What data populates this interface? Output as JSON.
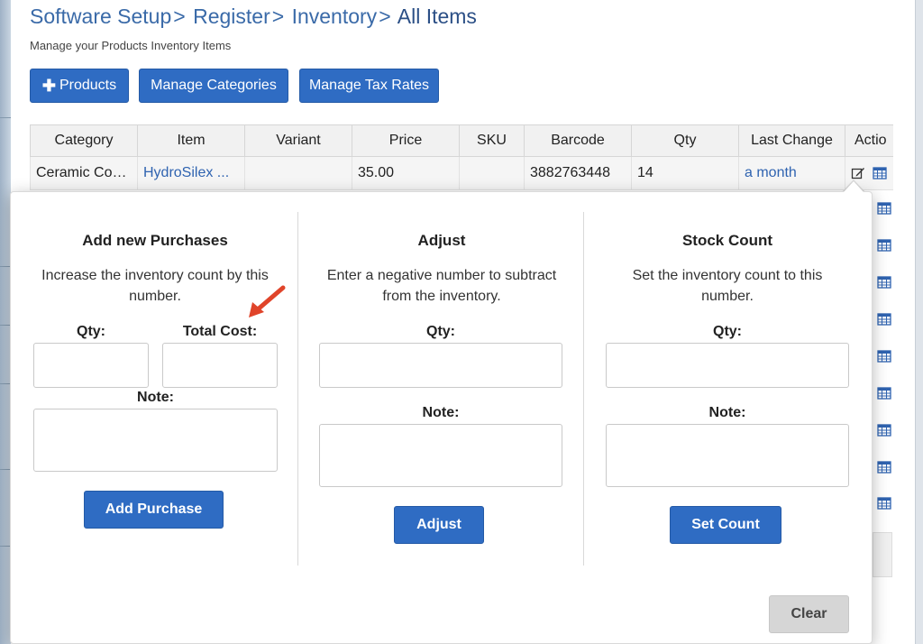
{
  "breadcrumb": {
    "items": [
      "Software Setup",
      "Register",
      "Inventory"
    ],
    "separator": ">",
    "current": "All Items"
  },
  "subtitle": "Manage your Products Inventory Items",
  "toolbar": {
    "products_icon": "plus-icon",
    "products_label": "Products",
    "categories_label": "Manage Categories",
    "tax_label": "Manage Tax Rates"
  },
  "table": {
    "headers": [
      "Category",
      "Item",
      "Variant",
      "Price",
      "SKU",
      "Barcode",
      "Qty",
      "Last Change",
      "Actio"
    ],
    "row": {
      "category": "Ceramic Coa...",
      "item": "HydroSilex ...",
      "variant": "",
      "price": "35.00",
      "sku": "",
      "barcode": "3882763448",
      "qty": "14",
      "last_change": "a month"
    }
  },
  "popover": {
    "purchases": {
      "title": "Add new Purchases",
      "description": "Increase the inventory count by this number.",
      "qty_label": "Qty:",
      "cost_label": "Total Cost:",
      "note_label": "Note:",
      "button": "Add Purchase"
    },
    "adjust": {
      "title": "Adjust",
      "description": "Enter a negative number to subtract from the inventory.",
      "qty_label": "Qty:",
      "note_label": "Note:",
      "button": "Adjust"
    },
    "stock": {
      "title": "Stock Count",
      "description": "Set the inventory count to this number.",
      "qty_label": "Qty:",
      "note_label": "Note:",
      "button": "Set Count"
    },
    "clear_button": "Clear"
  },
  "colors": {
    "accent": "#2f6cc3",
    "link": "#2f63b0",
    "annotation_arrow": "#e0442a"
  }
}
